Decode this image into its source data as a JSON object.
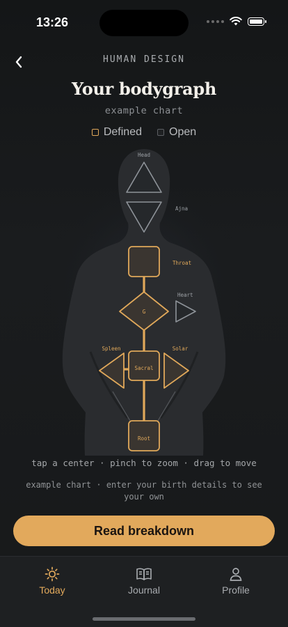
{
  "status": {
    "time": "13:26"
  },
  "header": {
    "eyebrow": "HUMAN DESIGN",
    "title": "Your bodygraph",
    "subtitle": "example chart"
  },
  "legend": {
    "defined": "Defined",
    "open": "Open"
  },
  "centers": {
    "head": "Head",
    "ajna": "Ajna",
    "throat": "Throat",
    "heart": "Heart",
    "g": "G",
    "spleen": "Spleen",
    "solar": "Solar",
    "sacral": "Sacral",
    "root": "Root"
  },
  "colors": {
    "defined": "#e0a85a",
    "defined_fill": "#3a3530",
    "open_stroke": "#8a8f95",
    "accent": "#e2a95c"
  },
  "hint": "tap a center · pinch to zoom · drag to move",
  "note": "example chart · enter your birth details to see your own",
  "cta": {
    "label": "Read breakdown"
  },
  "tabs": [
    {
      "label": "Today",
      "icon": "sun-icon",
      "active": true
    },
    {
      "label": "Journal",
      "icon": "book-icon",
      "active": false
    },
    {
      "label": "Profile",
      "icon": "person-icon",
      "active": false
    }
  ]
}
